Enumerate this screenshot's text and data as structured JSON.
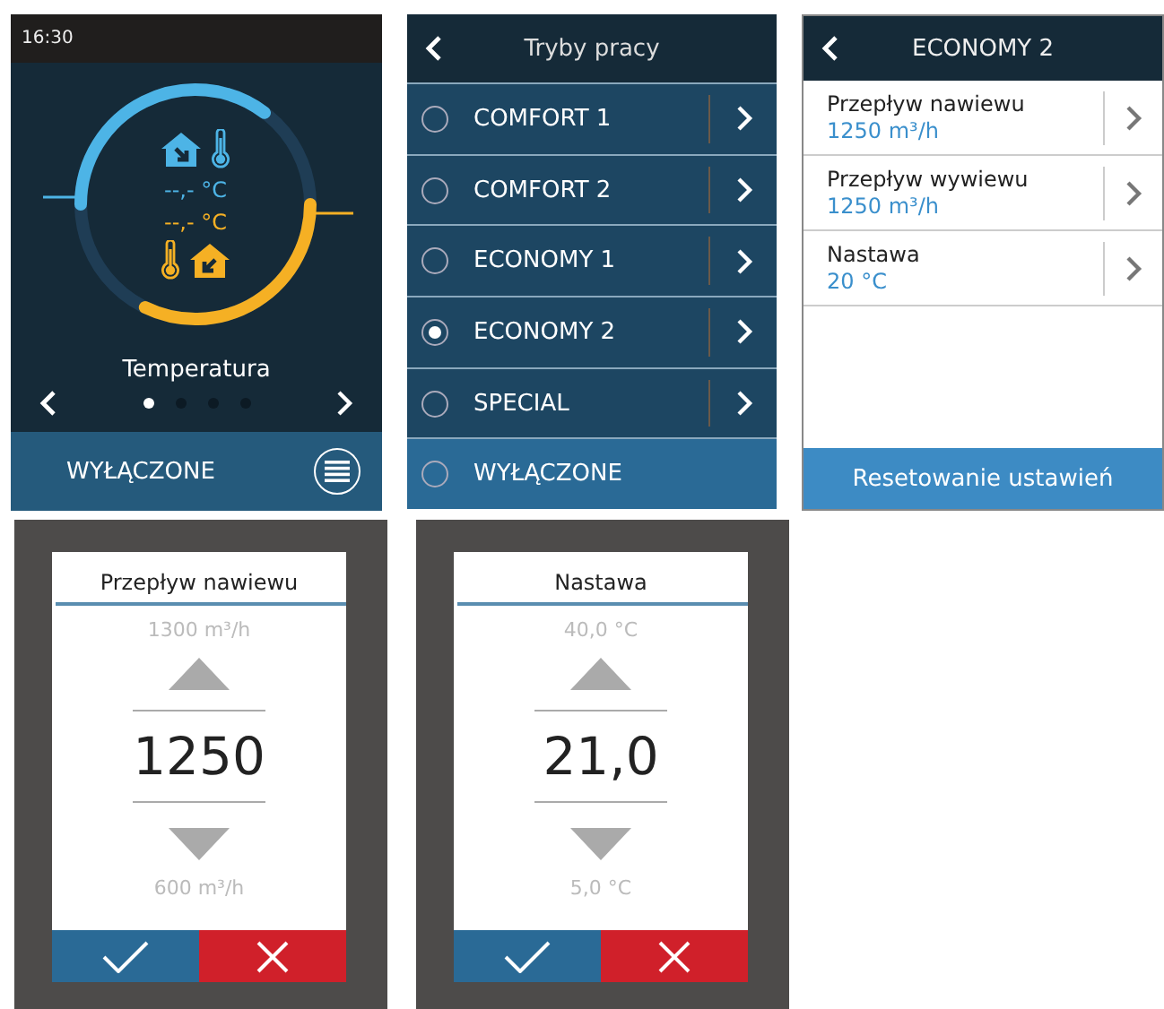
{
  "home": {
    "status_bar": {
      "time": "16:30"
    },
    "supply_temp": "--,- °C",
    "extract_temp": "--,- °C",
    "page_title": "Temperatura",
    "pager": [
      {
        "selected": true
      },
      {
        "selected": false
      },
      {
        "selected": false
      },
      {
        "selected": false
      }
    ],
    "mode": "WYŁĄCZONE"
  },
  "modes_screen": {
    "title": "Tryby pracy",
    "modes": [
      {
        "label": "COMFORT 1",
        "selected": false,
        "kind": "editable"
      },
      {
        "label": "COMFORT 2",
        "selected": false,
        "kind": "editable"
      },
      {
        "label": "ECONOMY 1",
        "selected": false,
        "kind": "editable"
      },
      {
        "label": "ECONOMY 2",
        "selected": true,
        "kind": "editable"
      },
      {
        "label": "SPECIAL",
        "selected": false,
        "kind": "editable"
      },
      {
        "label": "WYŁĄCZONE",
        "selected": false,
        "kind": "off"
      }
    ]
  },
  "settings_screen": {
    "title": "ECONOMY 2",
    "items": [
      {
        "label": "Przepływ nawiewu",
        "value": "1250 m³/h"
      },
      {
        "label": "Przepływ wywiewu",
        "value": "1250 m³/h"
      },
      {
        "label": "Nastawa",
        "value": "20 °C"
      }
    ],
    "reset_button": "Resetowanie ustawień"
  },
  "editors": [
    {
      "title": "Przepływ nawiewu",
      "max": "1300 m³/h",
      "value": "1250",
      "min": "600 m³/h"
    },
    {
      "title": "Nastawa",
      "max": "40,0 °C",
      "value": "21,0",
      "min": "5,0 °C"
    }
  ]
}
